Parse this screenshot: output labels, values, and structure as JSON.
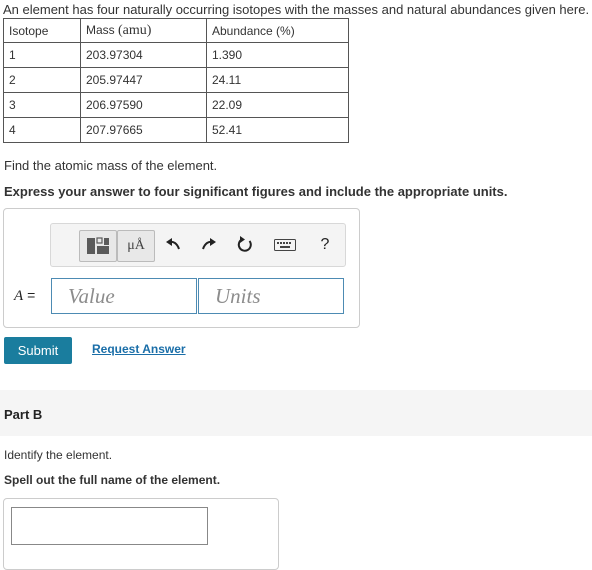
{
  "intro": "An element has four naturally occurring isotopes with the masses and natural abundances given here.",
  "table": {
    "headers": {
      "isotope": "Isotope",
      "mass": "Mass",
      "mass_unit": "(amu)",
      "abundance": "Abundance (%)"
    },
    "rows": [
      {
        "isotope": "1",
        "mass": "203.97304",
        "abundance": "1.390"
      },
      {
        "isotope": "2",
        "mass": "205.97447",
        "abundance": "24.11"
      },
      {
        "isotope": "3",
        "mass": "206.97590",
        "abundance": "22.09"
      },
      {
        "isotope": "4",
        "mass": "207.97665",
        "abundance": "52.41"
      }
    ]
  },
  "part_a": {
    "question": "Find the atomic mass of the element.",
    "instruction": "Express your answer to four significant figures and include the appropriate units.",
    "toolbar": {
      "units_button": "μÅ",
      "help": "?"
    },
    "answer_label": "A",
    "answer_equals": "=",
    "value_placeholder": "Value",
    "units_placeholder": "Units",
    "submit": "Submit",
    "request_answer": "Request Answer"
  },
  "part_b": {
    "title": "Part B",
    "question": "Identify the element.",
    "instruction": "Spell out the full name of the element."
  }
}
